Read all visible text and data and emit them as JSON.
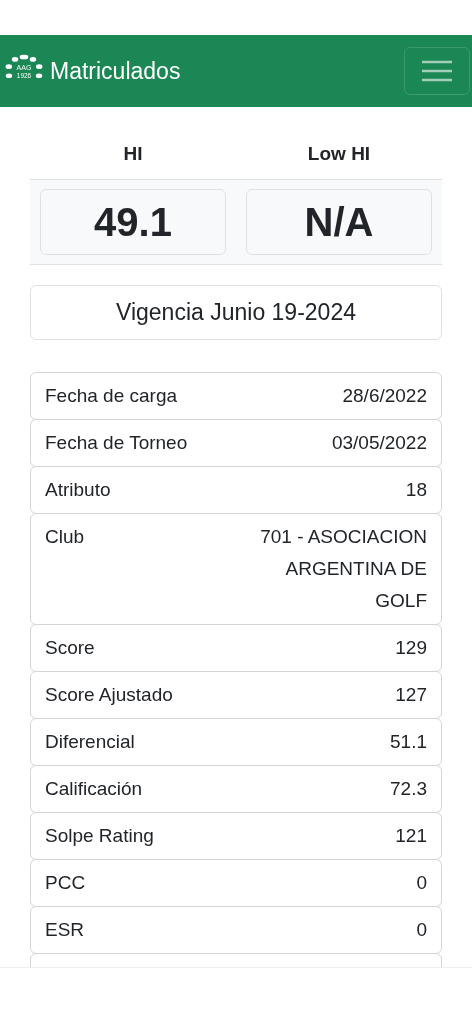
{
  "navbar": {
    "logo": {
      "text": "AAG",
      "year": "1926"
    },
    "title": "Matriculados"
  },
  "handicap": [
    {
      "label": "HI",
      "value": "49.1"
    },
    {
      "label": "Low HI",
      "value": "N/A"
    }
  ],
  "validity": "Vigencia Junio 19-2024",
  "details": [
    {
      "label": "Fecha de carga",
      "value": "28/6/2022"
    },
    {
      "label": "Fecha de Torneo",
      "value": "03/05/2022"
    },
    {
      "label": "Atributo",
      "value": "18"
    },
    {
      "label": "Club",
      "value": "701 - ASOCIACION ARGENTINA DE GOLF"
    },
    {
      "label": "Score",
      "value": "129"
    },
    {
      "label": "Score Ajustado",
      "value": "127"
    },
    {
      "label": "Diferencial",
      "value": "51.1"
    },
    {
      "label": "Calificación",
      "value": "72.3"
    },
    {
      "label": "Solpe Rating",
      "value": "121"
    },
    {
      "label": "PCC",
      "value": "0"
    },
    {
      "label": "ESR",
      "value": "0"
    }
  ]
}
